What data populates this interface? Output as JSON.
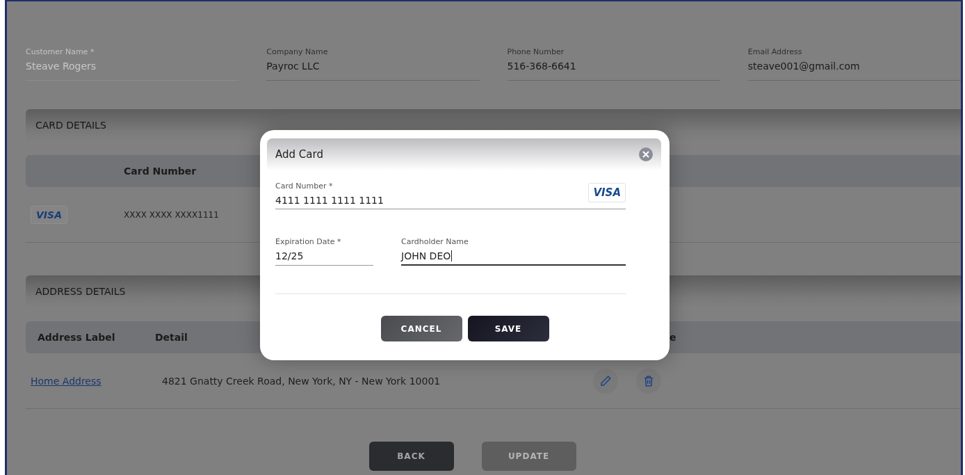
{
  "customer_fields": [
    {
      "label": "Customer Name *",
      "value": "Steave Rogers",
      "disabled": true
    },
    {
      "label": "Company Name",
      "value": "Payroc LLC",
      "disabled": false
    },
    {
      "label": "Phone Number",
      "value": "516-368-6641",
      "disabled": false
    },
    {
      "label": "Email Address",
      "value": "steave001@gmail.com",
      "disabled": false
    }
  ],
  "card_details": {
    "title": "CARD DETAILS",
    "columns": [
      "Card Number"
    ],
    "rows": [
      {
        "brand": "VISA",
        "number": "XXXX XXXX XXXX1111"
      }
    ]
  },
  "address_details": {
    "title": "ADDRESS DETAILS",
    "columns": [
      "Address Label",
      "Detail",
      "e"
    ],
    "rows": [
      {
        "label": "Home Address",
        "detail": "4821 Gnatty Creek Road, New York, NY - New York 10001"
      }
    ]
  },
  "buttons": [
    {
      "label": "BACK",
      "disabled": false
    },
    {
      "label": "UPDATE",
      "disabled": true
    }
  ],
  "dialog": {
    "title": "Add Card",
    "card_number": {
      "label": "Card Number *",
      "value": "4111 1111 1111 1111",
      "brand": "VISA"
    },
    "expiration": {
      "label": "Expiration Date *",
      "value": "12/25"
    },
    "cardholder": {
      "label": "Cardholder Name",
      "value": "JOHN DEO",
      "focused": true
    },
    "buttons": [
      {
        "label": "CANCEL",
        "kind": "secondary"
      },
      {
        "label": "SAVE",
        "kind": "primary"
      }
    ]
  }
}
